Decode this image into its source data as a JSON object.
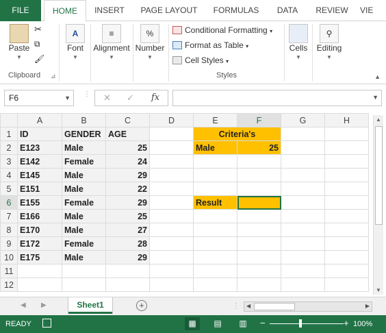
{
  "ribbon_tabs": [
    "FILE",
    "HOME",
    "INSERT",
    "PAGE LAYOUT",
    "FORMULAS",
    "DATA",
    "REVIEW",
    "VIE"
  ],
  "clipboard": {
    "paste": "Paste",
    "label": "Clipboard"
  },
  "font": {
    "label": "Font"
  },
  "alignment": {
    "label": "Alignment"
  },
  "number": {
    "label": "Number"
  },
  "styles": {
    "conditional": "Conditional Formatting",
    "format_table": "Format as Table",
    "cell_styles": "Cell Styles",
    "label": "Styles"
  },
  "cells": {
    "label": "Cells"
  },
  "editing": {
    "label": "Editing"
  },
  "formula_bar": {
    "name_box": "F6",
    "fx": "fx",
    "formula": ""
  },
  "columns": [
    "A",
    "B",
    "C",
    "D",
    "E",
    "F",
    "G",
    "H"
  ],
  "rows": [
    [
      "ID",
      "GENDER",
      "AGE",
      "",
      "Criteria's",
      "",
      "",
      ""
    ],
    [
      "E123",
      "Male",
      "25",
      "",
      "Male",
      "25",
      "",
      ""
    ],
    [
      "E142",
      "Female",
      "24",
      "",
      "",
      "",
      "",
      ""
    ],
    [
      "E145",
      "Male",
      "29",
      "",
      "",
      "",
      "",
      ""
    ],
    [
      "E151",
      "Male",
      "22",
      "",
      "",
      "",
      "",
      ""
    ],
    [
      "E155",
      "Female",
      "29",
      "",
      "Result",
      "",
      "",
      ""
    ],
    [
      "E166",
      "Male",
      "25",
      "",
      "",
      "",
      "",
      ""
    ],
    [
      "E170",
      "Male",
      "27",
      "",
      "",
      "",
      "",
      ""
    ],
    [
      "E172",
      "Female",
      "28",
      "",
      "",
      "",
      "",
      ""
    ],
    [
      "E175",
      "Male",
      "29",
      "",
      "",
      "",
      "",
      ""
    ],
    [
      "",
      "",
      "",
      "",
      "",
      "",
      "",
      ""
    ],
    [
      "",
      "",
      "",
      "",
      "",
      "",
      "",
      ""
    ]
  ],
  "sheet_tab": "Sheet1",
  "status": {
    "ready": "READY",
    "zoom": "100%"
  },
  "colors": {
    "excel_green": "#217346",
    "criteria_fill": "#ffc000"
  }
}
